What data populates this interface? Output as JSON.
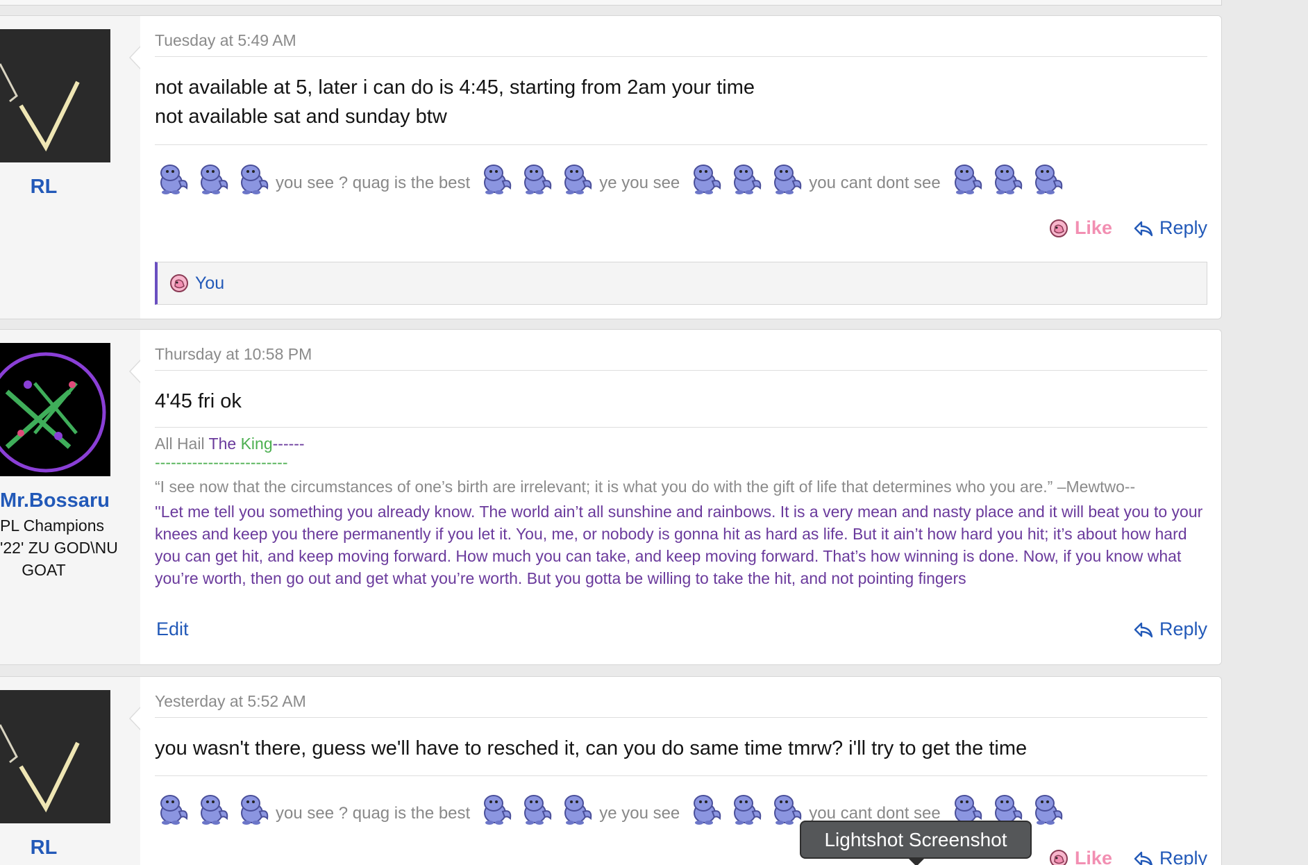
{
  "posts": [
    {
      "username": "RL",
      "date": "Tuesday at 5:49 AM",
      "message_lines": [
        "not available at 5, later i can do is 4:45, starting from 2am your time",
        "not available sat and sunday btw"
      ],
      "signature_texts": [
        "you see ? quag is the best",
        "ye you see",
        "you cant dont see"
      ],
      "like_label": "Like",
      "reply_label": "Reply",
      "likes_by": "You"
    },
    {
      "username": "Mr.Bossaru",
      "user_title_lines": [
        "PL Champions",
        "'22' ZU GOD\\NU",
        "GOAT"
      ],
      "date": "Thursday at 10:58 PM",
      "message": "4'45 fri ok",
      "signature": {
        "hail_prefix": "All Hail ",
        "hail_the": "The ",
        "hail_king": "King",
        "hail_dashes": "------",
        "green_dashes": "-------------------------",
        "quote1": "“I see now that the circumstances of one’s birth are irrelevant; it is what you do with the gift of life that determines who you are.” –Mewtwo--",
        "quote2": "''Let me tell you something you already know. The world ain’t all sunshine and rainbows. It is a very mean and nasty place and it will beat you to your knees and keep you there permanently if you let it. You, me, or nobody is gonna hit as hard as life. But it ain’t how hard you hit; it’s about how hard you can get hit, and keep moving forward. How much you can take, and keep moving forward. That’s how winning is done. Now, if you know what you’re worth, then go out and get what you’re worth. But you gotta be willing to take the hit, and not pointing fingers"
      },
      "edit_label": "Edit",
      "reply_label": "Reply"
    },
    {
      "username": "RL",
      "date": "Yesterday at 5:52 AM",
      "message": "you wasn't there, guess we'll have to resched it, can you do same time tmrw? i'll try to get the time",
      "signature_texts": [
        "you see ? quag is the best",
        "ye you see",
        "you cant dont see"
      ],
      "like_label": "Like",
      "reply_label": "Reply"
    }
  ],
  "tooltip": "Lightshot Screenshot",
  "colors": {
    "link": "#2259b8",
    "like": "#f28fb2",
    "quagsire": "#7b86d8",
    "likes_bar_accent": "#6a4fc0",
    "signature_purple": "#6a3a9c",
    "signature_green": "#4caf50"
  },
  "icons": [
    "quagsire-icon",
    "like-heart-icon",
    "reply-arrow-icon"
  ]
}
